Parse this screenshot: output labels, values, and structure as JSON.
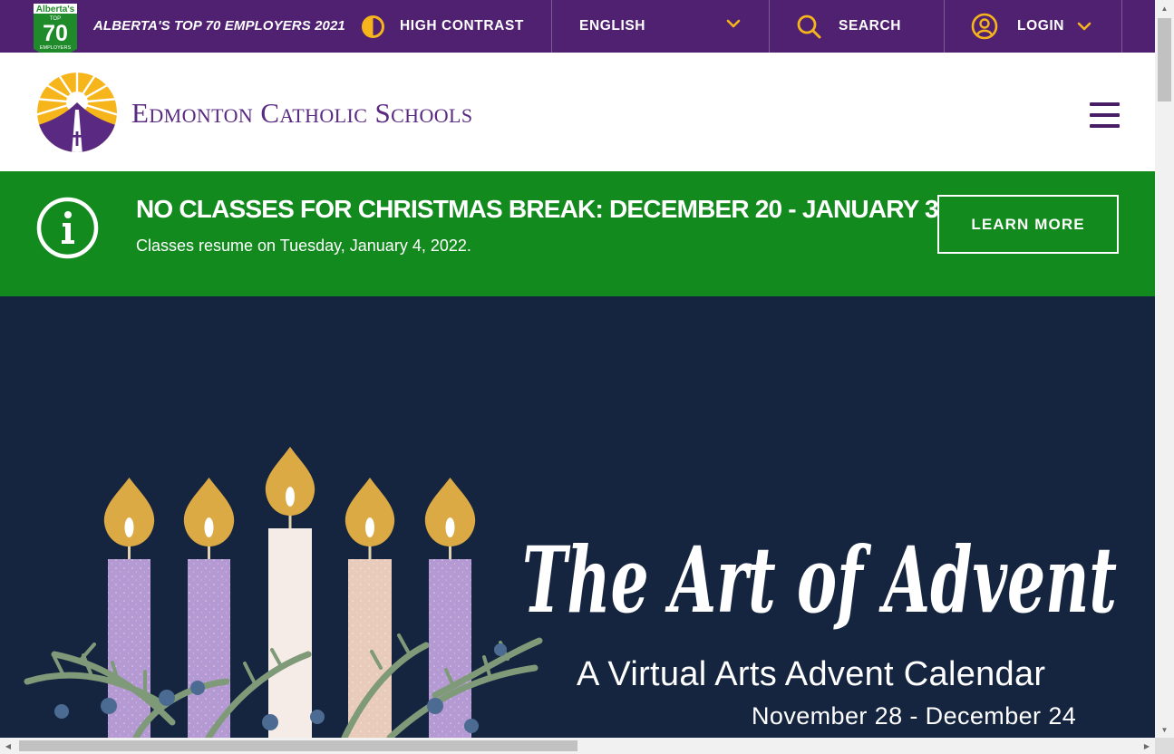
{
  "utility_bar": {
    "badge": {
      "line1": "Alberta's",
      "line2": "TOP",
      "number": "70",
      "line3": "EMPLOYERS",
      "year": "2021"
    },
    "badge_tagline": "ALBERTA'S TOP 70 EMPLOYERS 2021",
    "high_contrast_label": "HIGH CONTRAST",
    "language_value": "ENGLISH",
    "search_label": "SEARCH",
    "login_label": "LOGIN"
  },
  "header": {
    "school_name": "Edmonton Catholic Schools"
  },
  "alert": {
    "title": "NO CLASSES FOR CHRISTMAS BREAK: DECEMBER 20 - JANUARY 3",
    "body": "Classes resume on Tuesday, January 4, 2022.",
    "button_label": "LEARN MORE"
  },
  "hero": {
    "title": "The Art of Advent",
    "subtitle": "A Virtual Arts Advent Calendar",
    "dates": "November 28 - December 24"
  },
  "colors": {
    "utility_bg": "#4f2170",
    "brand_purple": "#5a2a82",
    "accent_gold": "#f5b51b",
    "alert_green": "#128a1e",
    "hero_navy": "#15253f"
  },
  "icons": [
    "contrast-icon",
    "chevron-down-icon",
    "search-icon",
    "user-icon",
    "menu-icon",
    "info-icon"
  ]
}
